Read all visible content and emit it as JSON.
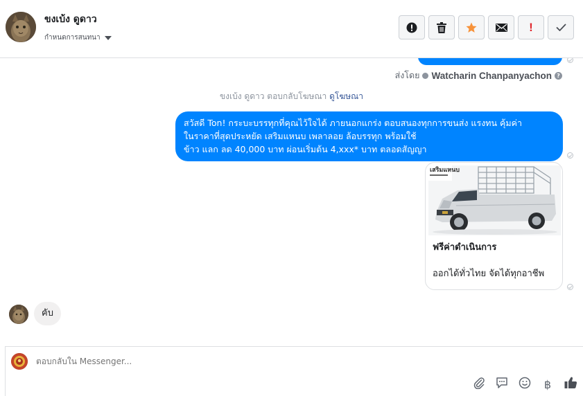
{
  "header": {
    "name": "ขงเบ้ง ดูดาว",
    "subtitle": "กำหนดการสนทนา"
  },
  "actions": {
    "spam_label": "!"
  },
  "conversation": {
    "sent_by_prefix": "ส่งโดย",
    "sent_by_name": "Watcharin Chanpanyachon",
    "help": "?",
    "ad_reply_text": "ขงเบ้ง ดูดาว ตอบกลับโฆษณา",
    "ad_link": "ดูโฆษณา",
    "message_lines": [
      "สวัสดี Ton! กระบะบรรทุกที่คุณไว้ใจได้ ภายนอกแกร่ง ตอบสนองทุกการขนส่ง แรงทน คุ้มค่า",
      "ในราคาที่สุดประหยัด เสริมแหนบ เพลาลอย ล้อบรรทุก พร้อมใช้",
      "ข้าว แลก ลด 40,000 บาท ผ่อนเริ่มต้น 4,xxx* บาท ตลอดสัญญา"
    ],
    "card": {
      "image_banner": "เสริมแหนบ",
      "title": "ฟรีค่าดำเนินการ",
      "description": "ออกได้ทั่วไทย จัดได้ทุกอาชีพ"
    },
    "reply_text": "คับ"
  },
  "composer": {
    "placeholder": "ตอบกลับใน Messenger...",
    "baht_symbol": "฿"
  }
}
